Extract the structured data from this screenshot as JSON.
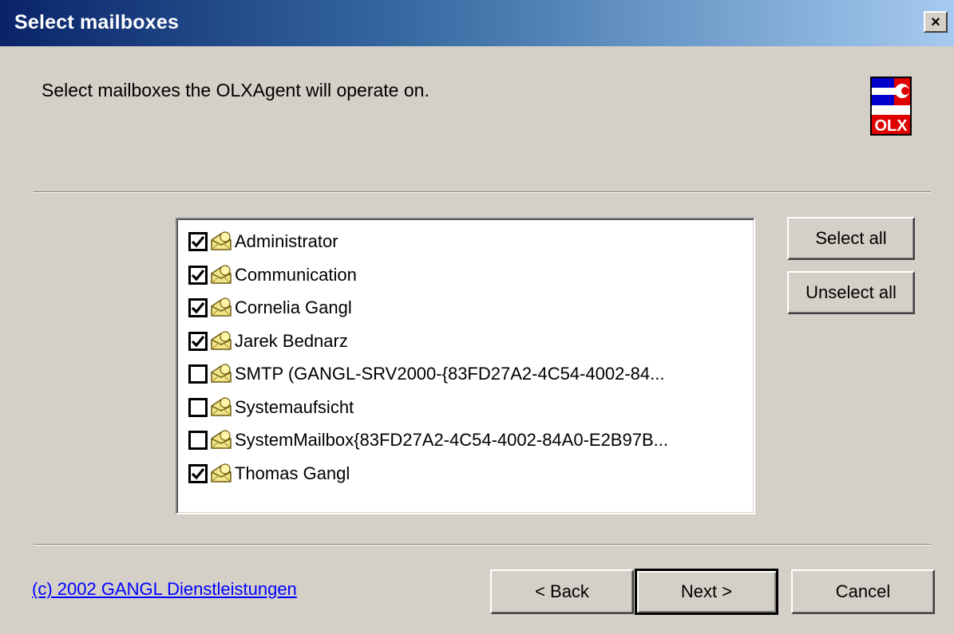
{
  "window": {
    "title": "Select mailboxes",
    "close_label": "×"
  },
  "header": {
    "description": "Select mailboxes the OLXAgent will operate on.",
    "logo_text": "OLX",
    "logo_icon": "olx-wrench-logo"
  },
  "mailboxes": [
    {
      "label": "Administrator",
      "checked": true
    },
    {
      "label": "Communication",
      "checked": true
    },
    {
      "label": "Cornelia Gangl",
      "checked": true
    },
    {
      "label": "Jarek Bednarz",
      "checked": true
    },
    {
      "label": "SMTP (GANGL-SRV2000-{83FD27A2-4C54-4002-84...",
      "checked": false
    },
    {
      "label": "Systemaufsicht",
      "checked": false
    },
    {
      "label": "SystemMailbox{83FD27A2-4C54-4002-84A0-E2B97B...",
      "checked": false
    },
    {
      "label": "Thomas Gangl",
      "checked": true
    }
  ],
  "side_buttons": {
    "select_all": "Select all",
    "unselect_all": "Unselect all"
  },
  "footer": {
    "copyright_link": "(c) 2002 GANGL Dienstleistungen",
    "back": "< Back",
    "next": "Next >",
    "cancel": "Cancel"
  },
  "colors": {
    "title_gradient_start": "#0a246a",
    "title_gradient_end": "#a6caf0",
    "dialog_bg": "#d4d0c8",
    "link": "#0000ff"
  }
}
